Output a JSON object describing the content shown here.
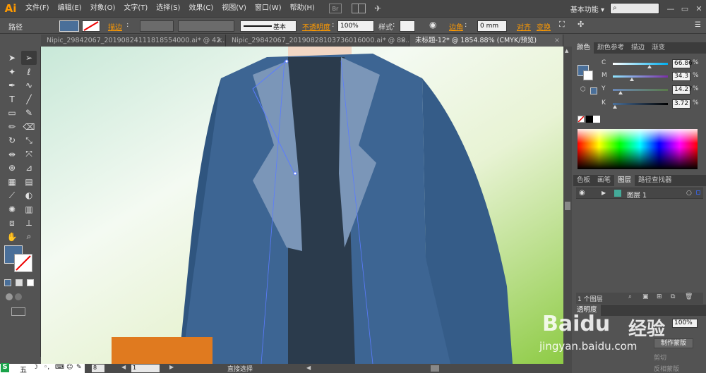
{
  "app": {
    "logo": "Ai",
    "menus": [
      "文件(F)",
      "编辑(E)",
      "对象(O)",
      "文字(T)",
      "选择(S)",
      "效果(C)",
      "视图(V)",
      "窗口(W)",
      "帮助(H)"
    ],
    "workspace": "基本功能",
    "workspace_arrow": "▾"
  },
  "control_bar": {
    "selection_label": "路径",
    "stroke_label": "描边",
    "brush_label": "基本",
    "opacity_label": "不透明度",
    "opacity_value": "100%",
    "style_label": "样式",
    "corner_label": "边角",
    "corner_value": "0 mm",
    "align_label": "对齐",
    "transform_label": "变换",
    "fill_color": "#4a6f99"
  },
  "tabs": [
    {
      "label": "Nipic_29842067_20190824111818554000.ai* @ 42...",
      "active": false
    },
    {
      "label": "Nipic_29842067_20190828103736016000.ai* @ 80...",
      "active": false
    },
    {
      "label": "未标题-12* @ 1854.88% (CMYK/预览)",
      "active": true
    }
  ],
  "toolbar": {
    "fill_color": "#4a6f99",
    "tools": [
      "selection-tool",
      "direct-selection-tool",
      "magic-wand-tool",
      "lasso-tool",
      "pen-tool",
      "curvature-tool",
      "type-tool",
      "line-tool",
      "rectangle-tool",
      "paintbrush-tool",
      "pencil-tool",
      "eraser-tool",
      "rotate-tool",
      "scale-tool",
      "width-tool",
      "free-transform-tool",
      "shape-builder-tool",
      "perspective-tool",
      "mesh-tool",
      "gradient-tool",
      "eyedropper-tool",
      "blend-tool",
      "symbol-sprayer-tool",
      "column-graph-tool",
      "artboard-tool",
      "slice-tool",
      "hand-tool",
      "zoom-tool"
    ]
  },
  "color_panel": {
    "tabs": [
      "颜色",
      "颜色参考",
      "描边",
      "渐变"
    ],
    "channels": [
      {
        "letter": "C",
        "value": "66.86",
        "fraction": 0.6686,
        "track": [
          "#ffffff",
          "#00aeef"
        ]
      },
      {
        "letter": "M",
        "value": "34.3",
        "fraction": 0.343,
        "track": [
          "#8fe6ff",
          "#7a2fa8"
        ]
      },
      {
        "letter": "Y",
        "value": "14.27",
        "fraction": 0.1427,
        "track": [
          "#6b88b8",
          "#5a7a4a"
        ]
      },
      {
        "letter": "K",
        "value": "3.72",
        "fraction": 0.0372,
        "track": [
          "#4a6f99",
          "#000000"
        ]
      }
    ],
    "percent": "%",
    "fill_color": "#4a6f99"
  },
  "layers_panel": {
    "tabs": [
      "色板",
      "画笔",
      "图层",
      "路径查找器"
    ],
    "layer_name": "图层 1",
    "layer_color": "#3a5fd0",
    "footer_count": "1 个图层"
  },
  "transparency_panel": {
    "title": "透明度",
    "opacity_value": "100%",
    "make_mask": "制作蒙版",
    "clip": "剪切",
    "invert_mask": "反相蒙版"
  },
  "status_bar": {
    "zoom": "8",
    "page": "1",
    "tool_name": "直接选择"
  },
  "watermark": {
    "brand": "Baidu",
    "brand_cn": "经验",
    "url": "jingyan.baidu.com"
  },
  "artwork": {
    "jacket_color": "#3d6593",
    "lapel_color": "#7b96b8",
    "shirt_color": "#2b3b4c",
    "bg_green": "#8ecb45",
    "box_color": "#e07a1f"
  }
}
